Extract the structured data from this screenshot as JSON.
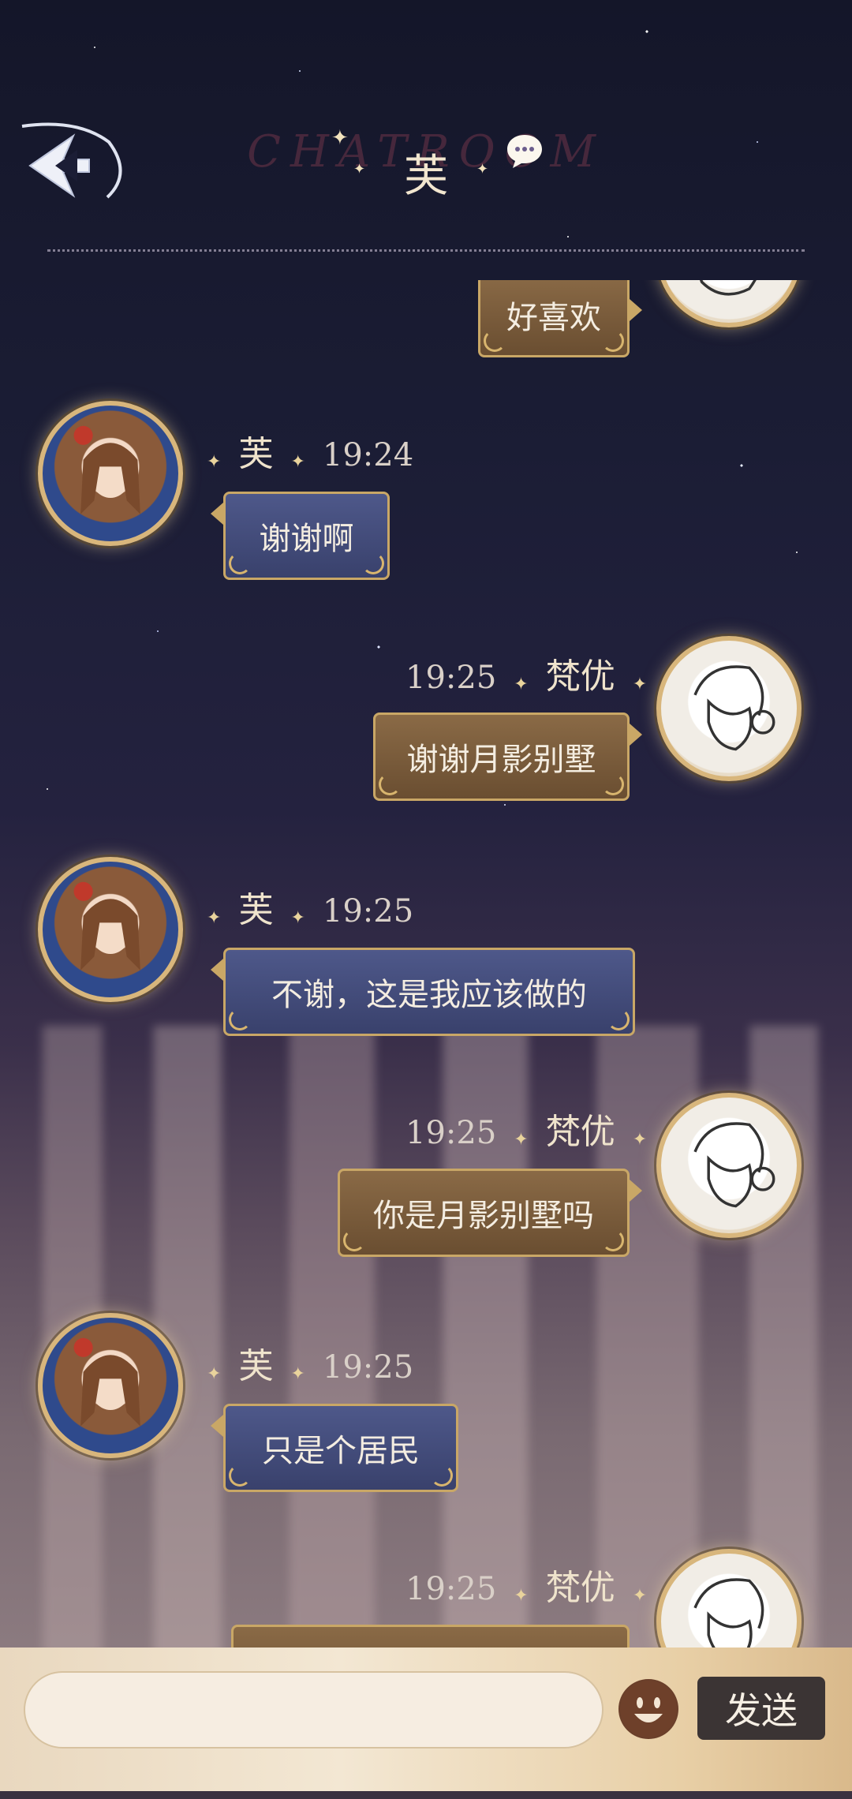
{
  "header": {
    "bg_title": "CHATROOM",
    "title": "芙",
    "back_icon": "back-arrow-icon",
    "chat_icon": "speech-bubble-icon"
  },
  "messages": [
    {
      "side": "right",
      "text": "好喜欢",
      "partial": true
    },
    {
      "side": "left",
      "name": "芙",
      "time": "19:24",
      "text": "谢谢啊"
    },
    {
      "side": "right",
      "name": "梵优",
      "time": "19:25",
      "text": "谢谢月影别墅"
    },
    {
      "side": "left",
      "name": "芙",
      "time": "19:25",
      "text": "不谢，这是我应该做的"
    },
    {
      "side": "right",
      "name": "梵优",
      "time": "19:25",
      "text": "你是月影别墅吗"
    },
    {
      "side": "left",
      "name": "芙",
      "time": "19:25",
      "text": "只是个居民"
    },
    {
      "side": "right",
      "name": "梵优",
      "time": "19:25",
      "text": ""
    }
  ],
  "input": {
    "placeholder": "",
    "value": ""
  },
  "emoji_icon": "smiley-face-icon",
  "send_label": "发送",
  "colors": {
    "bubble_left": "#434c7c",
    "bubble_right": "#7b5c3c",
    "bubble_border": "#c9a766",
    "text_light": "#f4ede1"
  }
}
